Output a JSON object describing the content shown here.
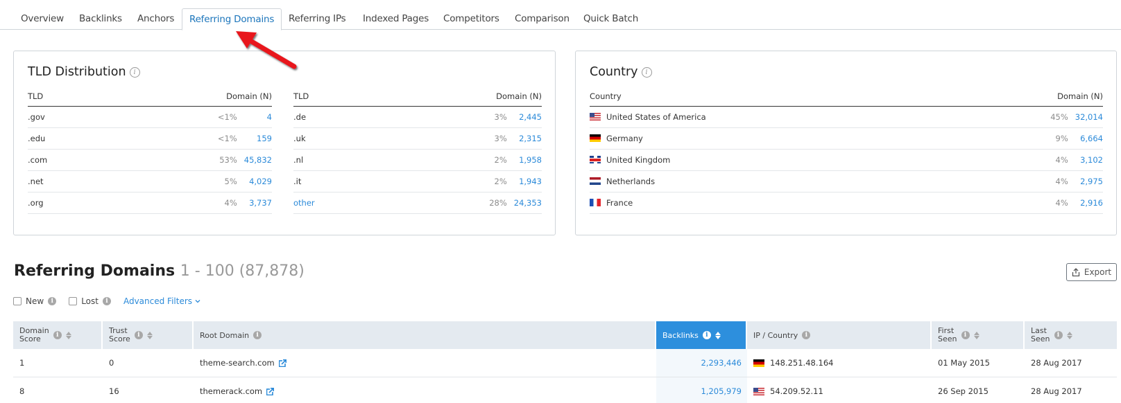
{
  "tabs": [
    {
      "label": "Overview",
      "active": false
    },
    {
      "label": "Backlinks",
      "active": false
    },
    {
      "label": "Anchors",
      "active": false
    },
    {
      "label": "Referring Domains",
      "active": true
    },
    {
      "label": "Referring IPs",
      "active": false
    },
    {
      "label": "Indexed Pages",
      "active": false
    },
    {
      "label": "Competitors",
      "active": false
    },
    {
      "label": "Comparison",
      "active": false
    },
    {
      "label": "Quick Batch",
      "active": false
    }
  ],
  "tld": {
    "title": "TLD Distribution",
    "col_tld": "TLD",
    "col_domain": "Domain (N)",
    "left": [
      {
        "tld": ".gov",
        "pct": "<1%",
        "count": "4"
      },
      {
        "tld": ".edu",
        "pct": "<1%",
        "count": "159"
      },
      {
        "tld": ".com",
        "pct": "53%",
        "count": "45,832"
      },
      {
        "tld": ".net",
        "pct": "5%",
        "count": "4,029"
      },
      {
        "tld": ".org",
        "pct": "4%",
        "count": "3,737"
      }
    ],
    "right": [
      {
        "tld": ".de",
        "pct": "3%",
        "count": "2,445"
      },
      {
        "tld": ".uk",
        "pct": "3%",
        "count": "2,315"
      },
      {
        "tld": ".nl",
        "pct": "2%",
        "count": "1,958"
      },
      {
        "tld": ".it",
        "pct": "2%",
        "count": "1,943"
      },
      {
        "tld": "other",
        "pct": "28%",
        "count": "24,353"
      }
    ]
  },
  "country": {
    "title": "Country",
    "col_country": "Country",
    "col_domain": "Domain (N)",
    "rows": [
      {
        "name": "United States of America",
        "flag": "us",
        "pct": "45%",
        "count": "32,014"
      },
      {
        "name": "Germany",
        "flag": "de",
        "pct": "9%",
        "count": "6,664"
      },
      {
        "name": "United Kingdom",
        "flag": "uk",
        "pct": "4%",
        "count": "3,102"
      },
      {
        "name": "Netherlands",
        "flag": "nl",
        "pct": "4%",
        "count": "2,975"
      },
      {
        "name": "France",
        "flag": "fr",
        "pct": "4%",
        "count": "2,916"
      }
    ]
  },
  "section": {
    "title": "Referring Domains",
    "range": "1 - 100 (87,878)",
    "export_label": "Export"
  },
  "filters": {
    "new_label": "New",
    "lost_label": "Lost",
    "advanced_label": "Advanced Filters"
  },
  "table": {
    "headers": {
      "domain_score": [
        "Domain",
        "Score"
      ],
      "trust_score": [
        "Trust",
        "Score"
      ],
      "root_domain": "Root Domain",
      "backlinks": "Backlinks",
      "ip_country": "IP / Country",
      "first_seen": [
        "First",
        "Seen"
      ],
      "last_seen": [
        "Last",
        "Seen"
      ]
    },
    "rows": [
      {
        "domain_score": "1",
        "trust_score": "0",
        "root_domain": "theme-search.com",
        "backlinks": "2,293,446",
        "flag": "de",
        "ip": "148.251.48.164",
        "first_seen": "01 May 2015",
        "last_seen": "28 Aug 2017"
      },
      {
        "domain_score": "8",
        "trust_score": "16",
        "root_domain": "themerack.com",
        "backlinks": "1,205,979",
        "flag": "us",
        "ip": "54.209.52.11",
        "first_seen": "26 Sep 2015",
        "last_seen": "28 Aug 2017"
      }
    ]
  },
  "colors": {
    "accent": "#2b8ad9",
    "active_tab": "#1b75bb",
    "header_active": "#2d8fdd",
    "annotation_arrow": "#e8141b"
  }
}
